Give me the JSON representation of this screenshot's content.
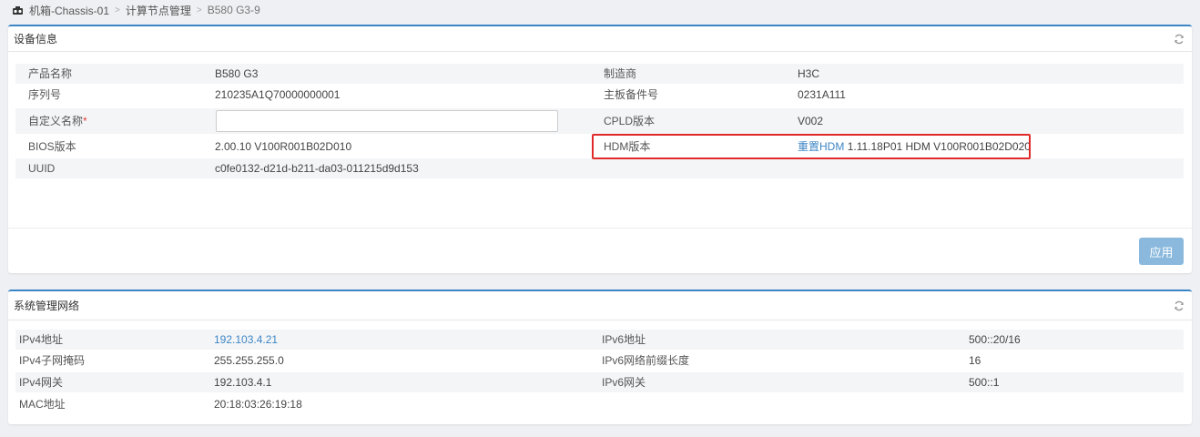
{
  "breadcrumb": {
    "root": "机箱-Chassis-01",
    "middle": "计算节点管理",
    "current": "B580 G3-9",
    "separator": ">"
  },
  "device_panel": {
    "title": "设备信息",
    "rows": [
      {
        "label1": "产品名称",
        "value1": "B580 G3",
        "label2": "制造商",
        "value2": "H3C"
      },
      {
        "label1": "序列号",
        "value1": "210235A1Q70000000001",
        "label2": "主板备件号",
        "value2": "0231A111"
      },
      {
        "label1": "自定义名称",
        "value1": "",
        "label2": "CPLD版本",
        "value2": "V002"
      },
      {
        "label1": "BIOS版本",
        "value1": "2.00.10 V100R001B02D010",
        "label2": "HDM版本",
        "value2": "1.11.18P01 HDM V100R001B02D020"
      },
      {
        "label1": "UUID",
        "value1": "c0fe0132-d21d-b211-da03-011215d9d153",
        "label2": "",
        "value2": ""
      }
    ],
    "required_mark": "*",
    "reset_hdm_link": "重置HDM",
    "apply_button": "应用"
  },
  "network_panel": {
    "title": "系统管理网络",
    "rows": [
      {
        "label1": "IPv4地址",
        "value1": "192.103.4.21",
        "label2": "IPv6地址",
        "value2": "500::20/16"
      },
      {
        "label1": "IPv4子网掩码",
        "value1": "255.255.255.0",
        "label2": "IPv6网络前缀长度",
        "value2": "16"
      },
      {
        "label1": "IPv4网关",
        "value1": "192.103.4.1",
        "label2": "IPv6网关",
        "value2": "500::1"
      },
      {
        "label1": "MAC地址",
        "value1": "20:18:03:26:19:18",
        "label2": "",
        "value2": ""
      }
    ]
  },
  "colors": {
    "accent": "#3d86c6",
    "highlight": "#e02a2a",
    "button_disabled": "#8ab9dd"
  }
}
